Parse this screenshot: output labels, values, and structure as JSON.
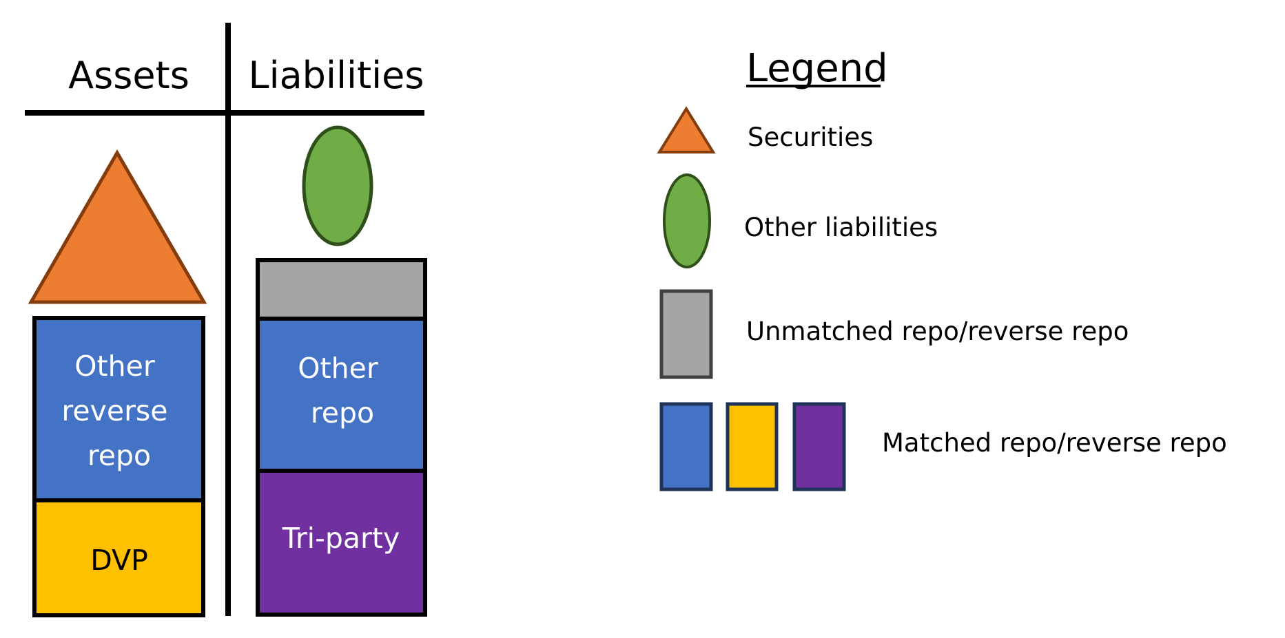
{
  "balance_sheet": {
    "assets_header": "Assets",
    "liabilities_header": "Liabilities",
    "assets": {
      "other_reverse_repo": [
        "Other",
        "reverse",
        "repo"
      ],
      "dvp": "DVP"
    },
    "liabilities": {
      "other_repo": [
        "Other",
        "repo"
      ],
      "tri_party": "Tri-party"
    }
  },
  "legend": {
    "title": "Legend",
    "items": [
      {
        "label": "Securities",
        "shape": "triangle",
        "color": "#ED7D31"
      },
      {
        "label": "Other liabilities",
        "shape": "ellipse",
        "color": "#70AD47"
      },
      {
        "label": "Unmatched repo/reverse repo",
        "shape": "rectangle",
        "color": "#A5A5A5"
      },
      {
        "label": "Matched repo/reverse repo",
        "shape": "rectangles",
        "colors": [
          "#4472C4",
          "#FFC000",
          "#7030A0"
        ]
      }
    ]
  }
}
